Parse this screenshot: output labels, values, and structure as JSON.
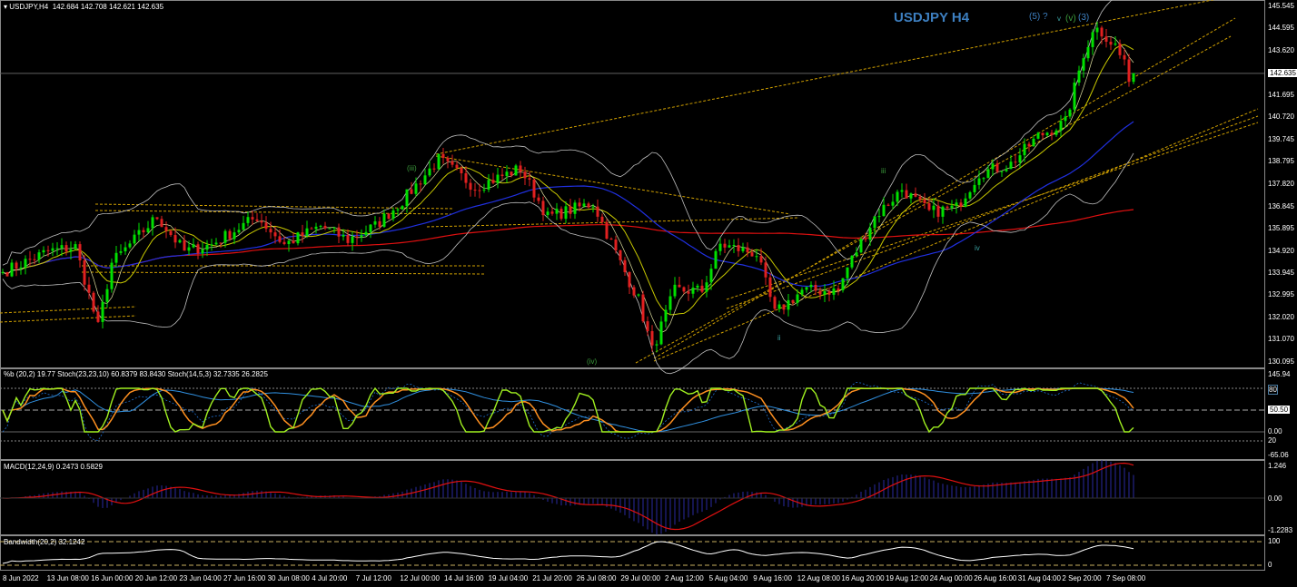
{
  "header": {
    "symbol": "USDJPY,H4",
    "ohlc": "142.684 142.708 142.621 142.635",
    "title": "USDJPY H4"
  },
  "waves": [
    {
      "text": "(iii)",
      "color": "#3c9c3c"
    },
    {
      "text": "(iv)",
      "color": "#3c9c3c"
    },
    {
      "text": "ii",
      "color": "#3aa0a0"
    },
    {
      "text": "iii",
      "color": "#3c9c3c"
    },
    {
      "text": "iv",
      "color": "#3aa0a0"
    },
    {
      "text": "(5) ?",
      "color": "#3d7fc0"
    },
    {
      "text": "v",
      "color": "#3aa0a0"
    },
    {
      "text": "(v)",
      "color": "#3c9c3c"
    },
    {
      "text": "(3)",
      "color": "#3d7fc0"
    }
  ],
  "price_axis": {
    "labels": [
      "145.545",
      "144.595",
      "143.620",
      "141.695",
      "140.720",
      "139.745",
      "138.795",
      "137.820",
      "136.845",
      "135.895",
      "134.920",
      "133.945",
      "132.995",
      "132.020",
      "131.070",
      "130.095"
    ],
    "current": "142.635",
    "range": [
      130.095,
      145.545
    ]
  },
  "stoch": {
    "label": "%b (20,2) 19.77  Stoch(23,23,10) 60.8379 83.8430  Stoch(14,5,3) 32.7335 26.2825",
    "axis": [
      "145.94",
      "80",
      "50.50",
      "0.00",
      "20",
      "-65.06"
    ]
  },
  "macd": {
    "label": "MACD(12,24,9) 0.2473 0.5829",
    "axis": [
      "1.246",
      "0.00",
      "-1.2283"
    ]
  },
  "bandwidth": {
    "label": "Bandwidth(20,2) 32.1242",
    "axis": [
      "100",
      "0"
    ]
  },
  "time_axis": [
    "8 Jun 2022",
    "13 Jun 08:00",
    "16 Jun 00:00",
    "20 Jun 12:00",
    "23 Jun 04:00",
    "27 Jun 16:00",
    "30 Jun 08:00",
    "4 Jul 20:00",
    "7 Jul 12:00",
    "12 Jul 00:00",
    "14 Jul 16:00",
    "19 Jul 04:00",
    "21 Jul 20:00",
    "26 Jul 08:00",
    "29 Jul 00:00",
    "2 Aug 12:00",
    "5 Aug 04:00",
    "9 Aug 16:00",
    "12 Aug 08:00",
    "16 Aug 20:00",
    "19 Aug 12:00",
    "24 Aug 00:00",
    "26 Aug 16:00",
    "31 Aug 04:00",
    "2 Sep 20:00",
    "7 Sep 08:00"
  ],
  "chart_data": {
    "type": "candlestick",
    "colors": {
      "up": "#00e000",
      "down": "#e02020",
      "ma_fast": "#c8c800",
      "ma_mid": "#2030e0",
      "ma_slow": "#e01010",
      "bands": "#c0c0c0"
    },
    "knots_bar_index": [
      0,
      10,
      16,
      21,
      24,
      34,
      40,
      46,
      56,
      62,
      70,
      76,
      82,
      88,
      96,
      104,
      114,
      120,
      130,
      136,
      140,
      143,
      148,
      154,
      158,
      166,
      170,
      176,
      184,
      186,
      192,
      198,
      204,
      210,
      215,
      222,
      228,
      234,
      238,
      241,
      244,
      245,
      248,
      249
    ],
    "knots_close": [
      134.0,
      134.9,
      135.1,
      131.6,
      134.4,
      136.4,
      134.9,
      135.2,
      136.4,
      135.2,
      136.0,
      135.4,
      136.0,
      137.1,
      138.9,
      137.7,
      138.5,
      136.4,
      137.0,
      134.4,
      132.8,
      130.6,
      133.2,
      133.2,
      135.2,
      134.8,
      132.2,
      133.2,
      133.2,
      134.2,
      136.4,
      137.6,
      136.6,
      136.8,
      138.3,
      138.7,
      139.9,
      140.5,
      143.5,
      144.8,
      143.8,
      143.9,
      142.5,
      142.64
    ]
  }
}
